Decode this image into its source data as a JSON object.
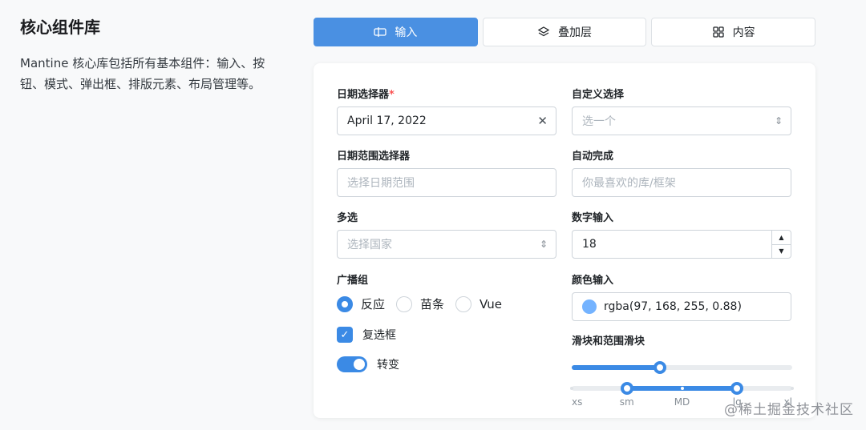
{
  "intro": {
    "title": "核心组件库",
    "description": "Mantine 核心库包括所有基本组件：输入、按钮、模式、弹出框、排版元素、布局管理等。"
  },
  "tabs": [
    {
      "label": "输入",
      "icon": "input-icon",
      "active": true
    },
    {
      "label": "叠加层",
      "icon": "layers-icon",
      "active": false
    },
    {
      "label": "内容",
      "icon": "grid-icon",
      "active": false
    }
  ],
  "form": {
    "date": {
      "label": "日期选择器",
      "required_mark": "*",
      "value": "April 17, 2022"
    },
    "custom_select": {
      "label": "自定义选择",
      "placeholder": "选一个"
    },
    "date_range": {
      "label": "日期范围选择器",
      "placeholder": "选择日期范围"
    },
    "autocomplete": {
      "label": "自动完成",
      "placeholder": "你最喜欢的库/框架"
    },
    "multiselect": {
      "label": "多选",
      "placeholder": "选择国家"
    },
    "number": {
      "label": "数字输入",
      "value": "18"
    },
    "radio_group": {
      "label": "广播组",
      "options": [
        {
          "label": "反应",
          "checked": true
        },
        {
          "label": "苗条",
          "checked": false
        },
        {
          "label": "Vue",
          "checked": false
        }
      ]
    },
    "color": {
      "label": "颜色输入",
      "value": "rgba(97, 168, 255, 0.88)",
      "swatch_color": "#61a8ff"
    },
    "checkbox": {
      "label": "复选框",
      "checked": true
    },
    "switch": {
      "label": "转变",
      "on": true
    },
    "sliders": {
      "label": "滑块和范围滑块",
      "slider_value_percent": 40,
      "range_marks": [
        "xs",
        "sm",
        "MD",
        "lg",
        "xl"
      ],
      "range_value": [
        "sm",
        "lg"
      ]
    }
  },
  "colors": {
    "accent": "#3b8ae5",
    "tab_active": "#4a90e2"
  },
  "watermark": "@稀土掘金技术社区"
}
